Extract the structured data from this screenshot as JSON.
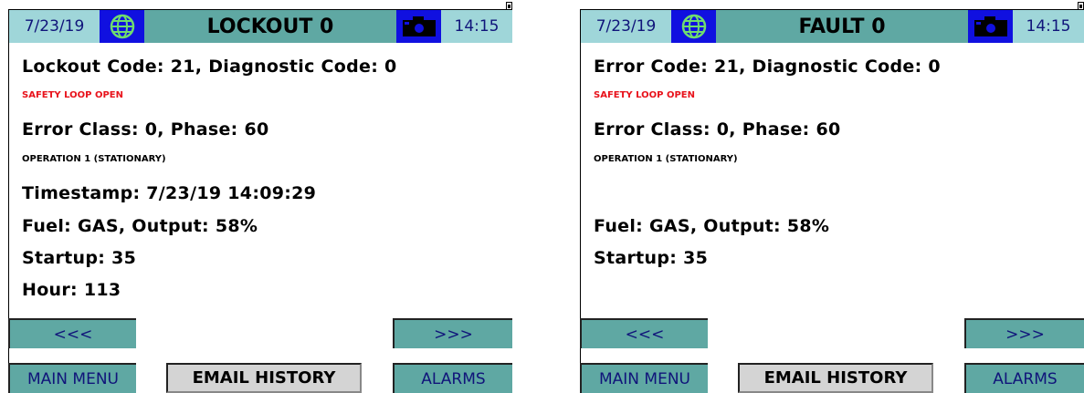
{
  "screens": [
    {
      "date": "7/23/19",
      "title": "LOCKOUT 0",
      "time": "14:15",
      "code_line": "Lockout Code: 21, Diagnostic Code: 0",
      "code_desc": "SAFETY LOOP OPEN",
      "class_line": "Error Class: 0, Phase: 60",
      "class_desc": "OPERATION 1 (STATIONARY)",
      "timestamp": "Timestamp: 7/23/19 14:09:29",
      "fuel": "Fuel: GAS, Output: 58%",
      "startup": "Startup: 35",
      "hour": "Hour: 113",
      "prev_label": "<<<",
      "next_label": ">>>",
      "main_menu_label": "MAIN MENU",
      "email_history_label": "EMAIL HISTORY",
      "alarms_label": "ALARMS"
    },
    {
      "date": "7/23/19",
      "title": "FAULT 0",
      "time": "14:15",
      "code_line": "Error Code: 21, Diagnostic Code: 0",
      "code_desc": "SAFETY LOOP OPEN",
      "class_line": "Error Class: 0, Phase: 60",
      "class_desc": "OPERATION 1 (STATIONARY)",
      "fuel": "Fuel: GAS, Output: 58%",
      "startup": "Startup: 35",
      "prev_label": "<<<",
      "next_label": ">>>",
      "main_menu_label": "MAIN MENU",
      "email_history_label": "EMAIL HISTORY",
      "alarms_label": "ALARMS"
    }
  ],
  "icons": {
    "date_side": "globe-icon",
    "time_side": "camera-icon"
  },
  "colors": {
    "header_teal": "#5fa8a3",
    "header_light": "#9fd6d9",
    "icon_blue": "#1010e0",
    "alert_red": "#e8121b",
    "button_grey": "#d4d4d4"
  }
}
